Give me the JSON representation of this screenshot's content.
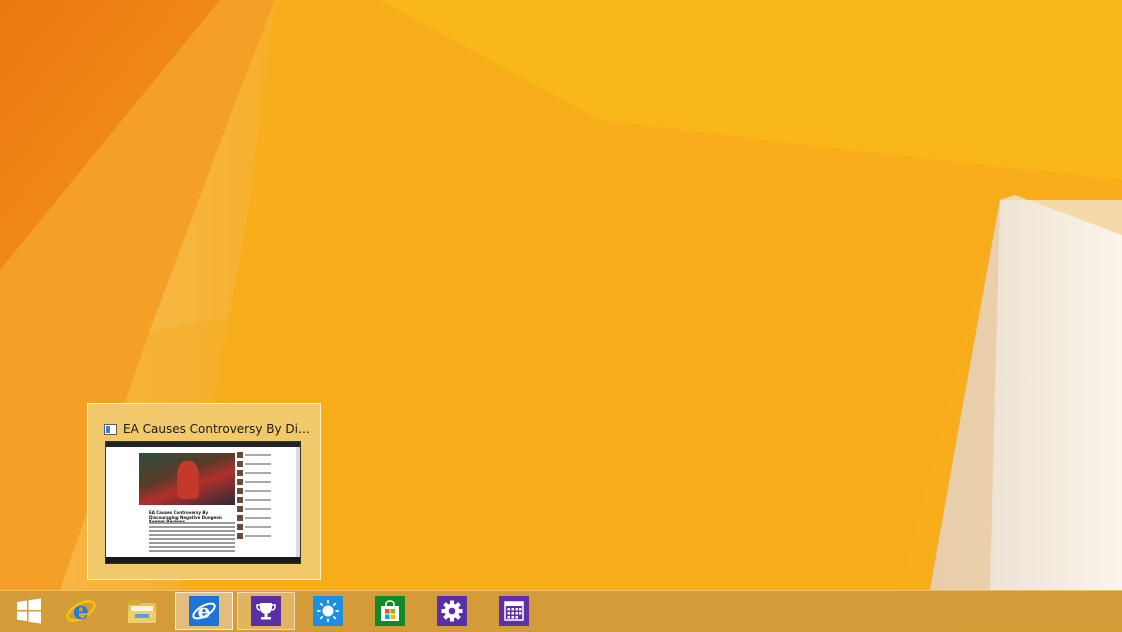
{
  "desktop": {
    "wallpaper_colors": {
      "dark_orange": "#ee7e10",
      "orange": "#f5a51c",
      "yellow": "#f9bb14",
      "cream": "#f7ecd8"
    }
  },
  "preview": {
    "title": "EA Causes Controversy By Disco...",
    "page_headline": "EA Causes Controversy By Discouraging Negative Dungeon Keeper Reviews"
  },
  "taskbar": {
    "background": "#cf9a3c",
    "items": [
      {
        "name": "start-button",
        "icon": "windows-logo-icon",
        "state": "normal"
      },
      {
        "name": "internet-explorer-pinned",
        "icon": "internet-explorer-icon",
        "state": "normal"
      },
      {
        "name": "file-explorer",
        "icon": "folder-icon",
        "state": "normal"
      },
      {
        "name": "internet-explorer-modern",
        "icon": "internet-explorer-tile-icon",
        "state": "active"
      },
      {
        "name": "achievements-app",
        "icon": "trophy-icon",
        "state": "hover"
      },
      {
        "name": "weather-app",
        "icon": "sun-icon",
        "state": "normal"
      },
      {
        "name": "store-app",
        "icon": "store-icon",
        "state": "normal"
      },
      {
        "name": "settings-app",
        "icon": "gear-icon",
        "state": "normal"
      },
      {
        "name": "calendar-app",
        "icon": "calendar-icon",
        "state": "normal"
      }
    ]
  }
}
